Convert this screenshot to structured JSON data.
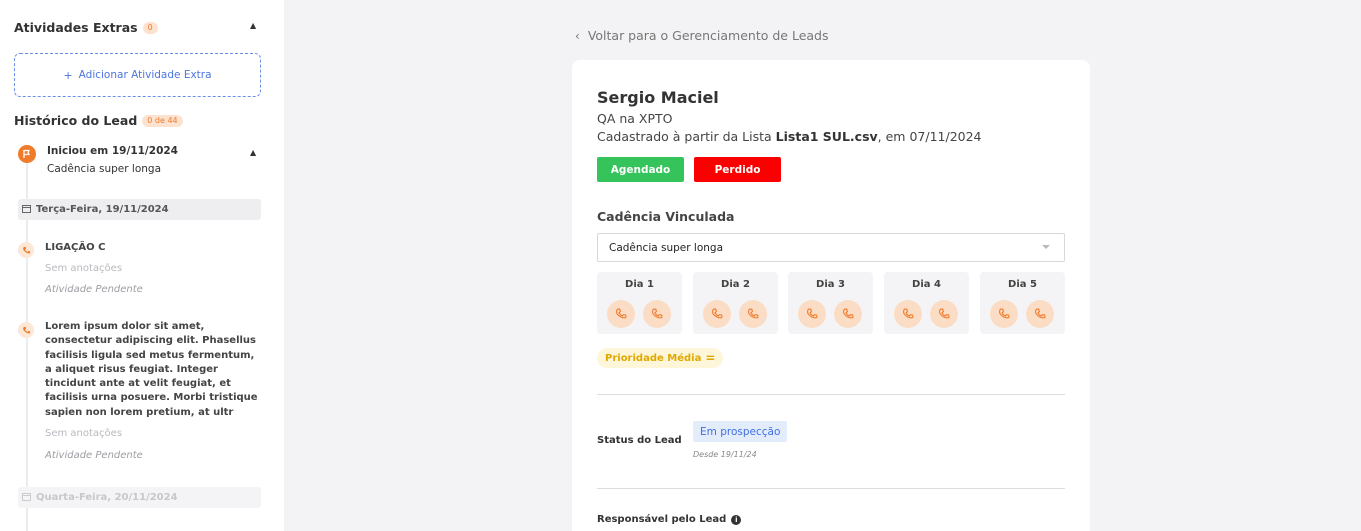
{
  "sidebar": {
    "extras": {
      "title": "Atividades Extras",
      "count": "0",
      "add_label": "Adicionar Atividade Extra"
    },
    "history": {
      "title": "Histórico do Lead",
      "count": "0 de 44",
      "start": {
        "title": "Iniciou em 19/11/2024",
        "subtitle": "Cadência super longa"
      },
      "days": [
        {
          "label": "Terça-Feira, 19/11/2024"
        },
        {
          "label": "Quarta-Feira, 20/11/2024"
        }
      ],
      "activities": [
        {
          "title": "LIGAÇÃO C",
          "notes": "Sem anotações",
          "status": "Atividade Pendente"
        },
        {
          "title": "Lorem ipsum dolor sit amet, consectetur adipiscing elit. Phasellus facilisis ligula sed metus fermentum, a aliquet risus feugiat. Integer tincidunt ante at velit feugiat, et facilisis urna posuere. Morbi tristique sapien non lorem pretium, at ultr",
          "notes": "Sem anotações",
          "status": "Atividade Pendente"
        }
      ]
    }
  },
  "main": {
    "back_label": "Voltar para o Gerenciamento de Leads",
    "lead": {
      "name": "Sergio Maciel",
      "role": "QA na XPTO",
      "registered_prefix": "Cadastrado à partir da Lista ",
      "list_name": "Lista1 SUL.csv",
      "registered_suffix": ", em 07/11/2024",
      "tags": [
        "Agendado",
        "Perdido"
      ]
    },
    "cadence": {
      "title": "Cadência Vinculada",
      "selected": "Cadência super longa",
      "days": [
        {
          "label": "Dia 1"
        },
        {
          "label": "Dia 2"
        },
        {
          "label": "Dia 3"
        },
        {
          "label": "Dia 4"
        },
        {
          "label": "Dia 5"
        }
      ],
      "priority": "Prioridade Média",
      "priority_icon": "="
    },
    "status": {
      "label": "Status do Lead",
      "value": "Em prospecção",
      "since": "Desde 19/11/24"
    },
    "responsible": {
      "label": "Responsável pelo Lead"
    }
  },
  "colors": {
    "accent": "#f07b2a",
    "green": "#35c45c",
    "red": "#fb0000",
    "blue": "#3f6fe0"
  }
}
